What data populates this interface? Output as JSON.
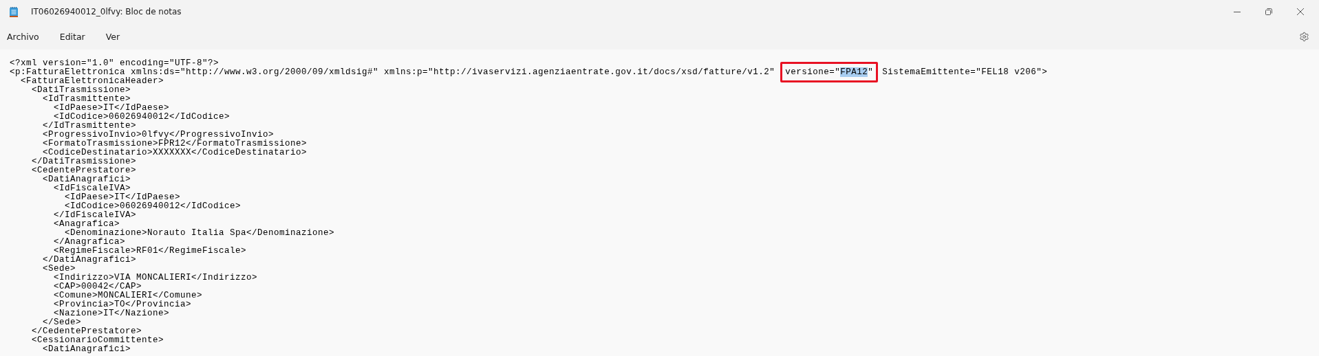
{
  "window": {
    "title": "IT06026940012_0lfvy: Bloc de notas"
  },
  "menu": [
    "Archivo",
    "Editar",
    "Ver"
  ],
  "editor": {
    "lines": [
      {
        "parts": [
          {
            "kind": "plain",
            "text": "<?xml version=\"1.0\" encoding=\"UTF-8\"?>"
          }
        ]
      },
      {
        "parts": [
          {
            "kind": "plain",
            "text": "<p:FatturaElettronica xmlns:ds=\"http://www.w3.org/2000/09/xmldsig#\" xmlns:p=\"http://ivaservizi.agenziaentrate.gov.it/docs/xsd/fatture/v1.2\""
          },
          {
            "kind": "annotation",
            "parts": [
              {
                "kind": "plain",
                "text": "versione=\""
              },
              {
                "kind": "selection",
                "text": "FPA12"
              },
              {
                "kind": "plain",
                "text": "\""
              }
            ]
          },
          {
            "kind": "plain",
            "text": "SistemaEmittente=\"FEL18 v206\">"
          }
        ]
      },
      {
        "parts": [
          {
            "kind": "plain",
            "text": "  <FatturaElettronicaHeader>"
          }
        ]
      },
      {
        "parts": [
          {
            "kind": "plain",
            "text": "    <DatiTrasmissione>"
          }
        ]
      },
      {
        "parts": [
          {
            "kind": "plain",
            "text": "      <IdTrasmittente>"
          }
        ]
      },
      {
        "parts": [
          {
            "kind": "plain",
            "text": "        <IdPaese>IT</IdPaese>"
          }
        ]
      },
      {
        "parts": [
          {
            "kind": "plain",
            "text": "        <IdCodice>06026940012</IdCodice>"
          }
        ]
      },
      {
        "parts": [
          {
            "kind": "plain",
            "text": "      </IdTrasmittente>"
          }
        ]
      },
      {
        "parts": [
          {
            "kind": "plain",
            "text": "      <ProgressivoInvio>0lfvy</ProgressivoInvio>"
          }
        ]
      },
      {
        "parts": [
          {
            "kind": "plain",
            "text": "      <FormatoTrasmissione>FPR12</FormatoTrasmissione>"
          }
        ]
      },
      {
        "parts": [
          {
            "kind": "plain",
            "text": "      <CodiceDestinatario>XXXXXXX</CodiceDestinatario>"
          }
        ]
      },
      {
        "parts": [
          {
            "kind": "plain",
            "text": "    </DatiTrasmissione>"
          }
        ]
      },
      {
        "parts": [
          {
            "kind": "plain",
            "text": "    <CedentePrestatore>"
          }
        ]
      },
      {
        "parts": [
          {
            "kind": "plain",
            "text": "      <DatiAnagrafici>"
          }
        ]
      },
      {
        "parts": [
          {
            "kind": "plain",
            "text": "        <IdFiscaleIVA>"
          }
        ]
      },
      {
        "parts": [
          {
            "kind": "plain",
            "text": "          <IdPaese>IT</IdPaese>"
          }
        ]
      },
      {
        "parts": [
          {
            "kind": "plain",
            "text": "          <IdCodice>06026940012</IdCodice>"
          }
        ]
      },
      {
        "parts": [
          {
            "kind": "plain",
            "text": "        </IdFiscaleIVA>"
          }
        ]
      },
      {
        "parts": [
          {
            "kind": "plain",
            "text": "        <Anagrafica>"
          }
        ]
      },
      {
        "parts": [
          {
            "kind": "plain",
            "text": "          <Denominazione>Norauto Italia Spa</Denominazione>"
          }
        ]
      },
      {
        "parts": [
          {
            "kind": "plain",
            "text": "        </Anagrafica>"
          }
        ]
      },
      {
        "parts": [
          {
            "kind": "plain",
            "text": "        <RegimeFiscale>RF01</RegimeFiscale>"
          }
        ]
      },
      {
        "parts": [
          {
            "kind": "plain",
            "text": "      </DatiAnagrafici>"
          }
        ]
      },
      {
        "parts": [
          {
            "kind": "plain",
            "text": "      <Sede>"
          }
        ]
      },
      {
        "parts": [
          {
            "kind": "plain",
            "text": "        <Indirizzo>VIA MONCALIERI</Indirizzo>"
          }
        ]
      },
      {
        "parts": [
          {
            "kind": "plain",
            "text": "        <CAP>00042</CAP>"
          }
        ]
      },
      {
        "parts": [
          {
            "kind": "plain",
            "text": "        <Comune>MONCALIERI</Comune>"
          }
        ]
      },
      {
        "parts": [
          {
            "kind": "plain",
            "text": "        <Provincia>TO</Provincia>"
          }
        ]
      },
      {
        "parts": [
          {
            "kind": "plain",
            "text": "        <Nazione>IT</Nazione>"
          }
        ]
      },
      {
        "parts": [
          {
            "kind": "plain",
            "text": "      </Sede>"
          }
        ]
      },
      {
        "parts": [
          {
            "kind": "plain",
            "text": "    </CedentePrestatore>"
          }
        ]
      },
      {
        "parts": [
          {
            "kind": "plain",
            "text": "    <CessionarioCommittente>"
          }
        ]
      },
      {
        "parts": [
          {
            "kind": "plain",
            "text": "      <DatiAnagrafici>"
          }
        ]
      }
    ]
  }
}
